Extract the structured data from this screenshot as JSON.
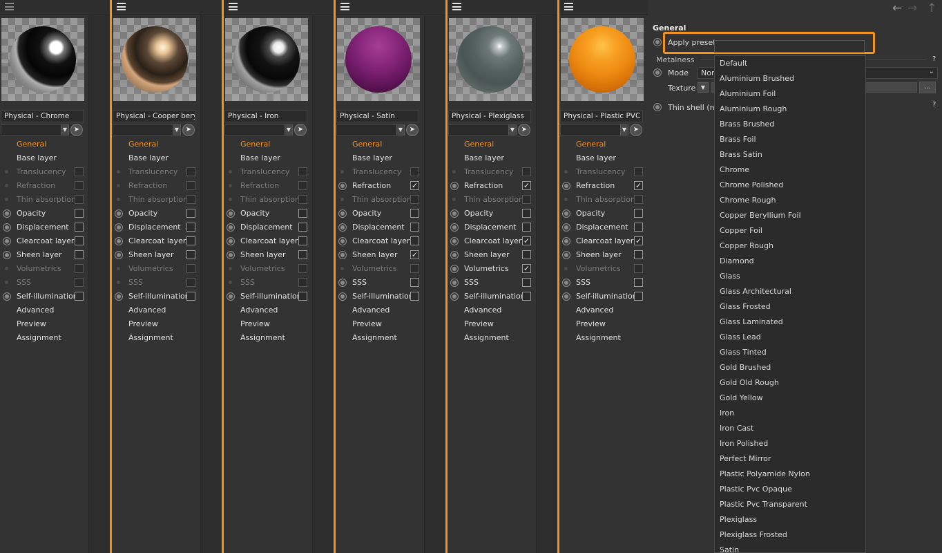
{
  "materials": [
    {
      "name": "Physical - Chrome",
      "sphere": "chrome",
      "channels": [
        {
          "label": "General",
          "state": "active",
          "dot": "none"
        },
        {
          "label": "Base layer",
          "state": "normal",
          "dot": "none"
        },
        {
          "label": "Translucency",
          "state": "disabled",
          "dot": "small",
          "cb": "off"
        },
        {
          "label": "Refraction",
          "state": "disabled",
          "dot": "small",
          "cb": "off"
        },
        {
          "label": "Thin absorption",
          "state": "disabled",
          "dot": "small",
          "cb": "off"
        },
        {
          "label": "Opacity",
          "state": "normal",
          "dot": "radio",
          "cb": "off"
        },
        {
          "label": "Displacement",
          "state": "normal",
          "dot": "radio",
          "cb": "off"
        },
        {
          "label": "Clearcoat layer",
          "state": "normal",
          "dot": "radio",
          "cb": "off"
        },
        {
          "label": "Sheen layer",
          "state": "normal",
          "dot": "radio",
          "cb": "off"
        },
        {
          "label": "Volumetrics",
          "state": "disabled",
          "dot": "small",
          "cb": "off"
        },
        {
          "label": "SSS",
          "state": "disabled",
          "dot": "small",
          "cb": "off"
        },
        {
          "label": "Self-illumination",
          "state": "normal",
          "dot": "radio",
          "cb": "off"
        },
        {
          "label": "Advanced",
          "state": "normal",
          "dot": "none"
        },
        {
          "label": "Preview",
          "state": "normal",
          "dot": "none"
        },
        {
          "label": "Assignment",
          "state": "normal",
          "dot": "none"
        }
      ]
    },
    {
      "name": "Physical - Cooper bery",
      "sphere": "copper",
      "channels": [
        {
          "label": "General",
          "state": "active",
          "dot": "none"
        },
        {
          "label": "Base layer",
          "state": "normal",
          "dot": "none"
        },
        {
          "label": "Translucency",
          "state": "disabled",
          "dot": "small",
          "cb": "off"
        },
        {
          "label": "Refraction",
          "state": "disabled",
          "dot": "small",
          "cb": "off"
        },
        {
          "label": "Thin absorption",
          "state": "disabled",
          "dot": "small",
          "cb": "off"
        },
        {
          "label": "Opacity",
          "state": "normal",
          "dot": "radio",
          "cb": "off"
        },
        {
          "label": "Displacement",
          "state": "normal",
          "dot": "radio",
          "cb": "off"
        },
        {
          "label": "Clearcoat layer",
          "state": "normal",
          "dot": "radio",
          "cb": "off"
        },
        {
          "label": "Sheen layer",
          "state": "normal",
          "dot": "radio",
          "cb": "off"
        },
        {
          "label": "Volumetrics",
          "state": "disabled",
          "dot": "small",
          "cb": "off"
        },
        {
          "label": "SSS",
          "state": "disabled",
          "dot": "small",
          "cb": "off"
        },
        {
          "label": "Self-illumination",
          "state": "normal",
          "dot": "radio",
          "cb": "off"
        },
        {
          "label": "Advanced",
          "state": "normal",
          "dot": "none"
        },
        {
          "label": "Preview",
          "state": "normal",
          "dot": "none"
        },
        {
          "label": "Assignment",
          "state": "normal",
          "dot": "none"
        }
      ]
    },
    {
      "name": "Physical - Iron",
      "sphere": "iron",
      "channels": [
        {
          "label": "General",
          "state": "active",
          "dot": "none"
        },
        {
          "label": "Base layer",
          "state": "normal",
          "dot": "none"
        },
        {
          "label": "Translucency",
          "state": "disabled",
          "dot": "small",
          "cb": "off"
        },
        {
          "label": "Refraction",
          "state": "disabled",
          "dot": "small",
          "cb": "off"
        },
        {
          "label": "Thin absorption",
          "state": "disabled",
          "dot": "small",
          "cb": "off"
        },
        {
          "label": "Opacity",
          "state": "normal",
          "dot": "radio",
          "cb": "off"
        },
        {
          "label": "Displacement",
          "state": "normal",
          "dot": "radio",
          "cb": "off"
        },
        {
          "label": "Clearcoat layer",
          "state": "normal",
          "dot": "radio",
          "cb": "off"
        },
        {
          "label": "Sheen layer",
          "state": "normal",
          "dot": "radio",
          "cb": "off"
        },
        {
          "label": "Volumetrics",
          "state": "disabled",
          "dot": "small",
          "cb": "off"
        },
        {
          "label": "SSS",
          "state": "disabled",
          "dot": "small",
          "cb": "off"
        },
        {
          "label": "Self-illumination",
          "state": "normal",
          "dot": "radio",
          "cb": "off"
        },
        {
          "label": "Advanced",
          "state": "normal",
          "dot": "none"
        },
        {
          "label": "Preview",
          "state": "normal",
          "dot": "none"
        },
        {
          "label": "Assignment",
          "state": "normal",
          "dot": "none"
        }
      ]
    },
    {
      "name": "Physical - Satin",
      "sphere": "satin",
      "channels": [
        {
          "label": "General",
          "state": "active",
          "dot": "none"
        },
        {
          "label": "Base layer",
          "state": "normal",
          "dot": "none"
        },
        {
          "label": "Translucency",
          "state": "disabled",
          "dot": "small",
          "cb": "off"
        },
        {
          "label": "Refraction",
          "state": "normal",
          "dot": "radio",
          "cb": "on"
        },
        {
          "label": "Thin absorption",
          "state": "disabled",
          "dot": "small",
          "cb": "off"
        },
        {
          "label": "Opacity",
          "state": "normal",
          "dot": "radio",
          "cb": "off"
        },
        {
          "label": "Displacement",
          "state": "normal",
          "dot": "radio",
          "cb": "off"
        },
        {
          "label": "Clearcoat layer",
          "state": "normal",
          "dot": "radio",
          "cb": "off"
        },
        {
          "label": "Sheen layer",
          "state": "normal",
          "dot": "radio",
          "cb": "on"
        },
        {
          "label": "Volumetrics",
          "state": "disabled",
          "dot": "small",
          "cb": "off"
        },
        {
          "label": "SSS",
          "state": "normal",
          "dot": "radio",
          "cb": "off"
        },
        {
          "label": "Self-illumination",
          "state": "normal",
          "dot": "radio",
          "cb": "off"
        },
        {
          "label": "Advanced",
          "state": "normal",
          "dot": "none"
        },
        {
          "label": "Preview",
          "state": "normal",
          "dot": "none"
        },
        {
          "label": "Assignment",
          "state": "normal",
          "dot": "none"
        }
      ]
    },
    {
      "name": "Physical - Plexiglass",
      "sphere": "plexiglass",
      "channels": [
        {
          "label": "General",
          "state": "active",
          "dot": "none"
        },
        {
          "label": "Base layer",
          "state": "normal",
          "dot": "none"
        },
        {
          "label": "Translucency",
          "state": "disabled",
          "dot": "small",
          "cb": "off"
        },
        {
          "label": "Refraction",
          "state": "normal",
          "dot": "radio",
          "cb": "on"
        },
        {
          "label": "Thin absorption",
          "state": "disabled",
          "dot": "small",
          "cb": "off"
        },
        {
          "label": "Opacity",
          "state": "normal",
          "dot": "radio",
          "cb": "off"
        },
        {
          "label": "Displacement",
          "state": "normal",
          "dot": "radio",
          "cb": "off"
        },
        {
          "label": "Clearcoat layer",
          "state": "normal",
          "dot": "radio",
          "cb": "on"
        },
        {
          "label": "Sheen layer",
          "state": "normal",
          "dot": "radio",
          "cb": "off"
        },
        {
          "label": "Volumetrics",
          "state": "normal",
          "dot": "radio",
          "cb": "on"
        },
        {
          "label": "SSS",
          "state": "normal",
          "dot": "radio",
          "cb": "off"
        },
        {
          "label": "Self-illumination",
          "state": "normal",
          "dot": "radio",
          "cb": "off"
        },
        {
          "label": "Advanced",
          "state": "normal",
          "dot": "none"
        },
        {
          "label": "Preview",
          "state": "normal",
          "dot": "none"
        },
        {
          "label": "Assignment",
          "state": "normal",
          "dot": "none"
        }
      ]
    },
    {
      "name": "Physical - Plastic PVC O",
      "sphere": "plastic",
      "channels": [
        {
          "label": "General",
          "state": "active",
          "dot": "none"
        },
        {
          "label": "Base layer",
          "state": "normal",
          "dot": "none"
        },
        {
          "label": "Translucency",
          "state": "disabled",
          "dot": "small",
          "cb": "off"
        },
        {
          "label": "Refraction",
          "state": "normal",
          "dot": "radio",
          "cb": "on"
        },
        {
          "label": "Thin absorption",
          "state": "disabled",
          "dot": "small",
          "cb": "off"
        },
        {
          "label": "Opacity",
          "state": "normal",
          "dot": "radio",
          "cb": "off"
        },
        {
          "label": "Displacement",
          "state": "normal",
          "dot": "radio",
          "cb": "off"
        },
        {
          "label": "Clearcoat layer",
          "state": "normal",
          "dot": "radio",
          "cb": "on"
        },
        {
          "label": "Sheen layer",
          "state": "normal",
          "dot": "radio",
          "cb": "off"
        },
        {
          "label": "Volumetrics",
          "state": "disabled",
          "dot": "small",
          "cb": "off"
        },
        {
          "label": "SSS",
          "state": "normal",
          "dot": "radio",
          "cb": "off"
        },
        {
          "label": "Self-illumination",
          "state": "normal",
          "dot": "radio",
          "cb": "off"
        },
        {
          "label": "Advanced",
          "state": "normal",
          "dot": "none"
        },
        {
          "label": "Preview",
          "state": "normal",
          "dot": "none"
        },
        {
          "label": "Assignment",
          "state": "normal",
          "dot": "none"
        }
      ]
    }
  ],
  "attributes": {
    "section_title": "General",
    "apply_preset_label": "Apply preset",
    "metalness_label": "Metalness",
    "mode_label": "Mode",
    "mode_value": "Nor",
    "texture_label": "Texture",
    "texture_more": "...",
    "thin_shell_label": "Thin shell (no",
    "help_mark": "?"
  },
  "preset_options": [
    "Default",
    "Aluminium Brushed",
    "Aluminium Foil",
    "Aluminium Rough",
    "Brass Brushed",
    "Brass Foil",
    "Brass Satin",
    "Chrome",
    "Chrome Polished",
    "Chrome Rough",
    "Copper Beryllium Foil",
    "Copper Foil",
    "Copper Rough",
    "Diamond",
    "Glass",
    "Glass Architectural",
    "Glass Frosted",
    "Glass Laminated",
    "Glass Lead",
    "Glass Tinted",
    "Gold Brushed",
    "Gold Old Rough",
    "Gold Yellow",
    "Iron",
    "Iron Cast",
    "Iron Polished",
    "Perfect Mirror",
    "Plastic Polyamide Nylon",
    "Plastic Pvc Opaque",
    "Plastic Pvc Transparent",
    "Plexiglass",
    "Plexiglass Frosted",
    "Satin"
  ],
  "colors": {
    "accent": "#f2931e",
    "background": "#333333"
  }
}
